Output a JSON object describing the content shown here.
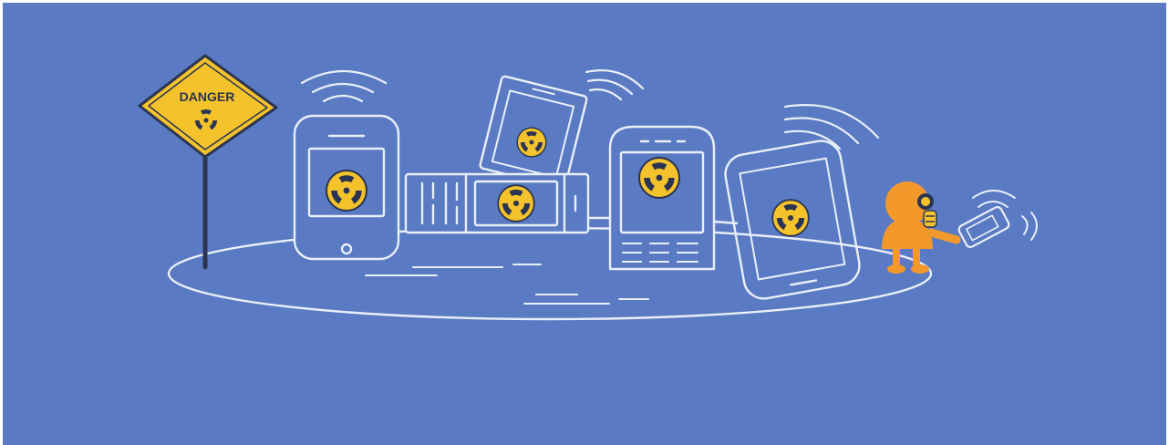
{
  "illustration": {
    "sign_text": "DANGER",
    "icons": [
      "danger-sign",
      "radiation-symbol",
      "smartphone",
      "feature-phone",
      "slider-phone",
      "gas-mask-figure",
      "wifi-waves"
    ]
  },
  "colors": {
    "background": "#5a7bc3",
    "line": "#e9eff8",
    "hazard_yellow": "#f4c22b",
    "figure_orange": "#f3982a",
    "outline_dark": "#2b3552"
  }
}
